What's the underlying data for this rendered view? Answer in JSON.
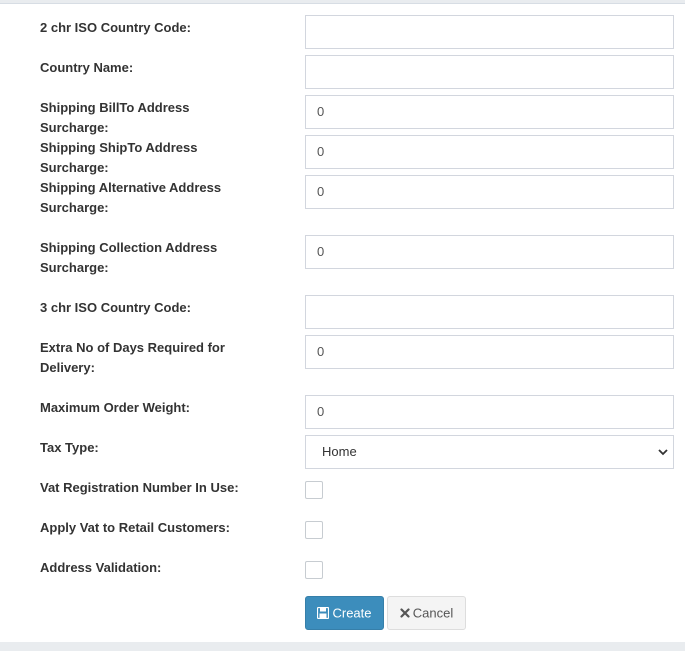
{
  "form": {
    "fields": [
      {
        "label": "2 chr ISO Country Code:",
        "type": "text",
        "value": ""
      },
      {
        "label": "Country Name:",
        "type": "text",
        "value": ""
      },
      {
        "label": "Shipping BillTo Address Surcharge:",
        "type": "text",
        "value": "0"
      },
      {
        "label": "Shipping ShipTo Address Surcharge:",
        "type": "text",
        "value": "0"
      },
      {
        "label": "Shipping Alternative Address Surcharge:",
        "type": "text",
        "value": "0"
      },
      {
        "label": "Shipping Collection Address Surcharge:",
        "type": "text",
        "value": "0"
      },
      {
        "label": "3 chr ISO Country Code:",
        "type": "text",
        "value": ""
      },
      {
        "label": "Extra No of Days Required for Delivery:",
        "type": "text",
        "value": "0"
      },
      {
        "label": "Maximum Order Weight:",
        "type": "text",
        "value": "0"
      },
      {
        "label": "Tax Type:",
        "type": "select",
        "value": "Home"
      },
      {
        "label": "Vat Registration Number In Use:",
        "type": "checkbox",
        "checked": false
      },
      {
        "label": "Apply Vat to Retail Customers:",
        "type": "checkbox",
        "checked": false
      },
      {
        "label": "Address Validation:",
        "type": "checkbox",
        "checked": false
      }
    ]
  },
  "buttons": {
    "create_label": "Create",
    "create_icon": "save-icon",
    "cancel_label": "Cancel",
    "cancel_icon": "times-icon"
  },
  "colors": {
    "primary": "#3c8dbc",
    "default_button": "#f4f4f4",
    "label_text": "#333333"
  }
}
